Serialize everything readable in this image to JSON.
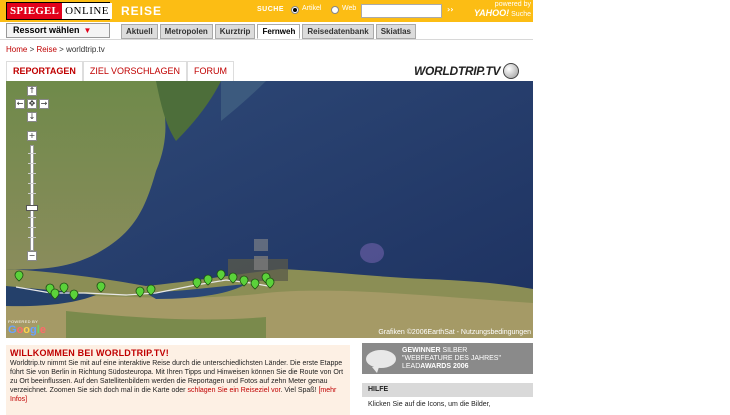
{
  "header": {
    "brand_spiegel": "SPIEGEL",
    "brand_online": "ONLINE",
    "section": "REISE",
    "search_label": "SUCHE",
    "radio_artikel": "Artikel",
    "radio_web": "Web",
    "search_value": "",
    "go": "››",
    "powered_by": "powered by",
    "yahoo": "YAHOO!",
    "suche": "Suche",
    "accent": "#fcbd14",
    "brand_red": "#e2001a"
  },
  "nav": {
    "ressort_label": "Ressort wählen",
    "tabs": [
      "Aktuell",
      "Metropolen",
      "Kurztrip",
      "Fernweh",
      "Reisedatenbank",
      "Skiatlas"
    ],
    "active_tab": "Fernweh"
  },
  "breadcrumb": {
    "home": "Home",
    "reise": "Reise",
    "current": "worldtrip.tv",
    "sep": ">"
  },
  "content_tabs": [
    "REPORTAGEN",
    "ZIEL VORSCHLAGEN",
    "FORUM"
  ],
  "logo_text": "WORLDTRIP.TV",
  "map": {
    "credit": "Grafiken ©2006EarthSat - Nutzungsbedingungen",
    "powered_by": "POWERED BY",
    "google": "Google",
    "controls": {
      "pan_up": "↑",
      "pan_left": "←",
      "pan_center": "✥",
      "pan_right": "→",
      "pan_down": "↓",
      "zoom_in": "+",
      "zoom_out": "−"
    }
  },
  "welcome": {
    "title": "WILLKOMMEN BEI WORLDTRIP.TV!",
    "text_1": "Worldtrip.tv nimmt Sie mit auf eine interaktive Reise durch die unterschiedlichsten Länder. Die erste Etappe führt Sie von Berlin in Richtung Südosteuropa. Mit Ihren Tipps und Hinweisen können Sie die Route von Ort zu Ort beeinflussen. Auf den Satellitenbildern werden die Reportagen und Fotos auf zehn Meter genau verzeichnet. Zoomen Sie sich doch mal in die Karte oder ",
    "link": "schlagen Sie ein Reiseziel vor",
    "text_2": ". Viel Spaß!",
    "more": "[mehr Infos]"
  },
  "award": {
    "line1_bold": "GEWINNER",
    "line1_rest": " SILBER",
    "line2": "\"WEBFEATURE DES JAHRES\"",
    "line3_a": "LEAD",
    "line3_b": "AWARDS 2006"
  },
  "help": {
    "header": "HILFE",
    "text": "Klicken Sie auf die Icons, um die Bilder,"
  }
}
